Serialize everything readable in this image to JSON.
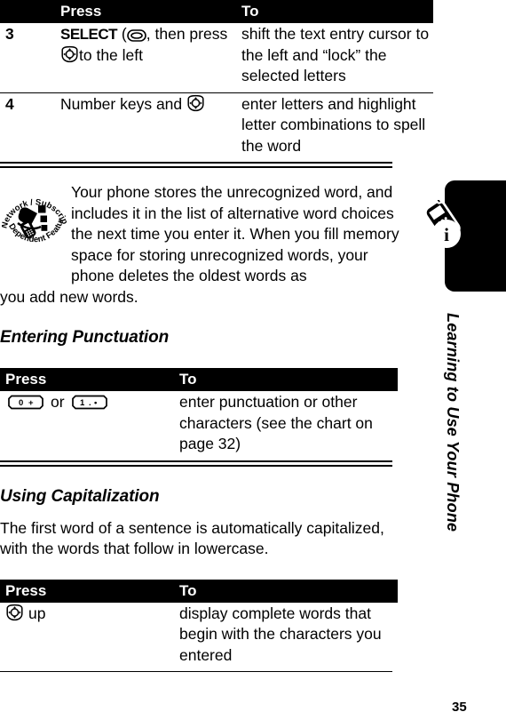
{
  "page": {
    "number": "35",
    "sidebar_title": "Learning to Use Your Phone"
  },
  "table_top": {
    "headers": {
      "num": "",
      "press": "Press",
      "to": "To"
    },
    "rows": [
      {
        "num": "3",
        "press_pre": "SELECT",
        "press_icon": "softkey-icon",
        "press_mid": ", then press",
        "press_icon2": "navigation-key-icon",
        "press_post": "to the left",
        "to": "shift the text entry cursor to the left and “lock” the selected letters"
      },
      {
        "num": "4",
        "press_pre": "Number keys and",
        "press_icon": "navigation-key-icon",
        "press_mid": "",
        "press_post": "",
        "to": "enter letters and highlight letter combinations to spell the word"
      }
    ]
  },
  "note": {
    "badge_icon": "network-subscription-dependent-feature-icon",
    "badge_text_top": "Network / Subscription",
    "badge_text_bottom": "Dependent  Feature",
    "text": "Your phone stores the unrecognized word, and includes it in the list of alternative word choices the next time you enter it. When you fill memory space for storing unrecognized words, your phone deletes the oldest words as",
    "tail": "you add new words."
  },
  "section_punctuation": {
    "heading": "Entering Punctuation",
    "table": {
      "headers": {
        "press": "Press",
        "to": "To"
      },
      "rows": [
        {
          "press_icon": "key-0-plus-icon",
          "press_mid": "or",
          "press_icon2": "key-1-dot-icon",
          "to": "enter punctuation or other characters (see the chart on page 32)"
        }
      ]
    }
  },
  "section_capitalization": {
    "heading": "Using Capitalization",
    "paragraph": "The first word of a sentence is automatically capitalized, with the words that follow in lowercase.",
    "table": {
      "headers": {
        "press": "Press",
        "to": "To"
      },
      "rows": [
        {
          "press_icon": "navigation-key-icon",
          "press_label": "up",
          "to": "display complete words that begin with the characters you entered"
        }
      ]
    }
  }
}
